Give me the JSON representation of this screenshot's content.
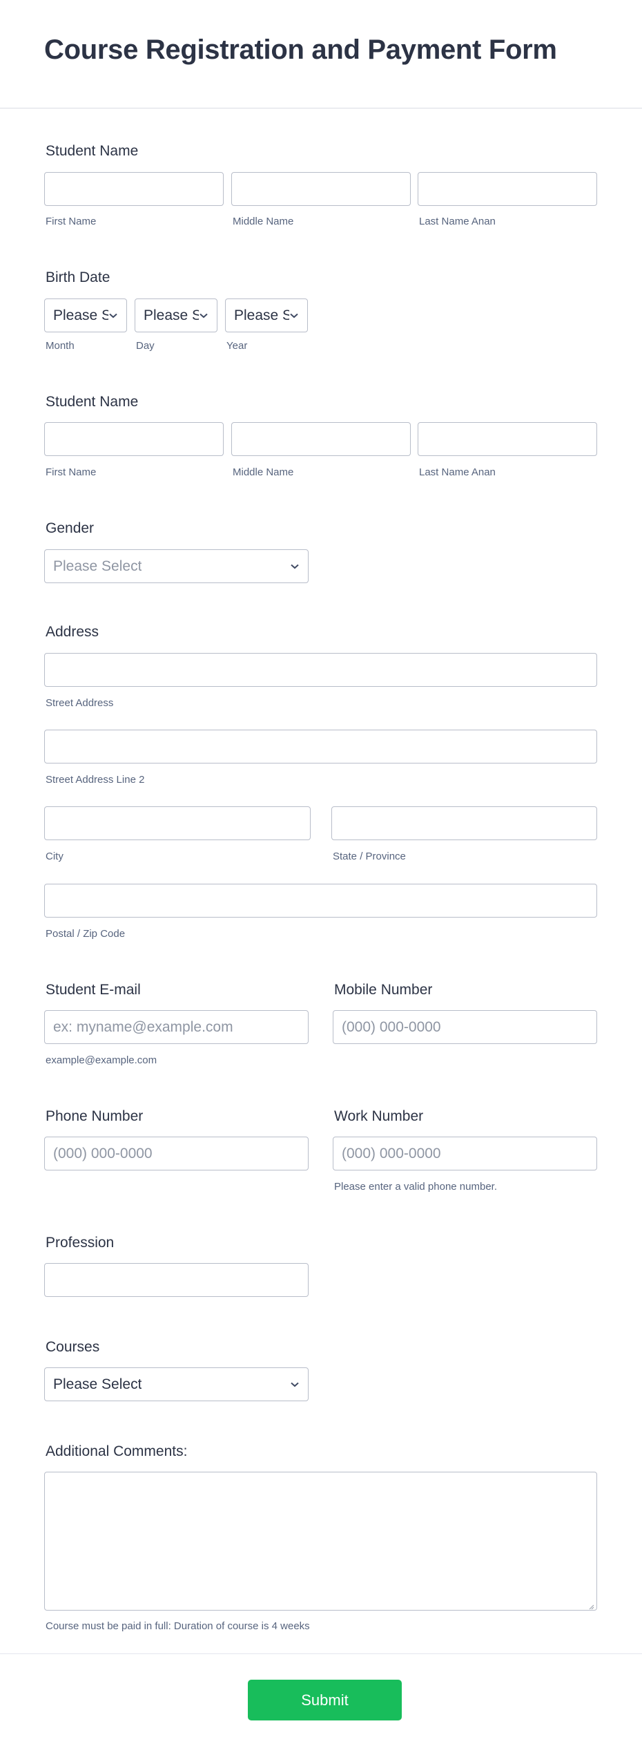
{
  "header": {
    "title": "Course Registration and Payment Form"
  },
  "student_name_1": {
    "label": "Student Name",
    "first": {
      "value": "",
      "sublabel": "First Name"
    },
    "middle": {
      "value": "",
      "sublabel": "Middle Name"
    },
    "last": {
      "value": "",
      "sublabel": "Last Name Anan"
    }
  },
  "birth_date": {
    "label": "Birth Date",
    "month": {
      "value": "Please Select",
      "sublabel": "Month"
    },
    "day": {
      "value": "Please Select",
      "sublabel": "Day"
    },
    "year": {
      "value": "Please Select",
      "sublabel": "Year"
    }
  },
  "student_name_2": {
    "label": "Student Name",
    "first": {
      "value": "",
      "sublabel": "First Name"
    },
    "middle": {
      "value": "",
      "sublabel": "Middle Name"
    },
    "last": {
      "value": "",
      "sublabel": "Last Name Anan"
    }
  },
  "gender": {
    "label": "Gender",
    "placeholder": "Please Select"
  },
  "address": {
    "label": "Address",
    "street": {
      "value": "",
      "sublabel": "Street Address"
    },
    "street2": {
      "value": "",
      "sublabel": "Street Address Line 2"
    },
    "city": {
      "value": "",
      "sublabel": "City"
    },
    "state": {
      "value": "",
      "sublabel": "State / Province"
    },
    "postal": {
      "value": "",
      "sublabel": "Postal / Zip Code"
    }
  },
  "email": {
    "label": "Student E-mail",
    "placeholder": "ex: myname@example.com",
    "sublabel": "example@example.com"
  },
  "mobile": {
    "label": "Mobile Number",
    "placeholder": "(000) 000-0000"
  },
  "phone": {
    "label": "Phone Number",
    "placeholder": "(000) 000-0000"
  },
  "work": {
    "label": "Work Number",
    "placeholder": "(000) 000-0000",
    "sublabel": "Please enter a valid phone number."
  },
  "profession": {
    "label": "Profession",
    "value": ""
  },
  "courses": {
    "label": "Courses",
    "value": "Please Select"
  },
  "comments": {
    "label": "Additional Comments:",
    "value": "",
    "sublabel": "Course must be paid in full: Duration of course is 4 weeks"
  },
  "submit": {
    "label": "Submit"
  },
  "colors": {
    "accent": "#18bd5b",
    "text": "#2c3345",
    "sublabel": "#57647e",
    "border": "#b8bdc9"
  }
}
